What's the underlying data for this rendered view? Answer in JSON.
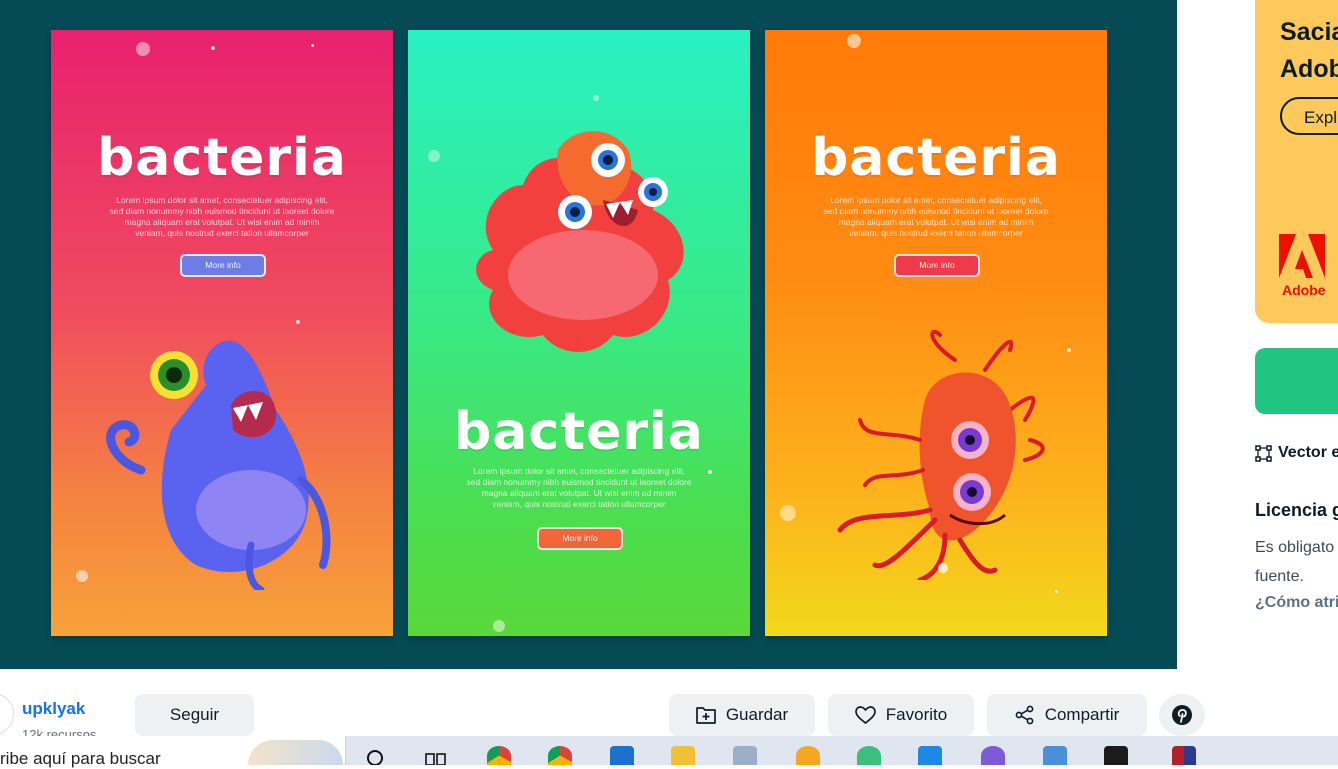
{
  "preview": {
    "posters": [
      {
        "title": "bacteria",
        "body": "Lorem ipsum dolor sit amet, consectetuer adipiscing elit, sed diam nonummy nibh euismod tincidunt ut laoreet dolore magna aliquam erat volutpat. Ut wisi enim ad minim veniam, quis nostrud exerci tation ullamcorper",
        "button": "More info"
      },
      {
        "title": "bacteria",
        "body": "Lorem ipsum dolor sit amet, consectetuer adipiscing elit, sed diam nonummy nibh euismod tincidunt ut laoreet dolore magna aliquam erat volutpat. Ut wisi enim ad minim veniam, quis nostrud exerci tation ullamcorper",
        "button": "More info"
      },
      {
        "title": "bacteria",
        "body": "Lorem ipsum dolor sit amet, consectetuer adipiscing elit, sed diam nonummy nibh euismod tincidunt ut laoreet dolore magna aliquam erat volutpat. Ut wisi enim ad minim veniam, quis nostrud exerci tation ullamcorper",
        "button": "More info"
      }
    ]
  },
  "sidebar": {
    "promo": {
      "text": "Sacia\nAdob",
      "button": "Expl",
      "brand": "Adobe"
    },
    "vector_label": "Vector e",
    "license": {
      "title": "Licencia g",
      "text": "Es obligato\nfuente.",
      "link": "¿Cómo atri"
    }
  },
  "author": {
    "name": "upklyak",
    "resources": "12k recursos"
  },
  "actions": {
    "follow": "Seguir",
    "save": "Guardar",
    "favorite": "Favorito",
    "share": "Compartir"
  },
  "taskbar": {
    "search_placeholder": "ribe aquí para buscar"
  },
  "colors": {
    "preview_bg": "#064a55",
    "promo_bg": "#fdc95a",
    "download": "#1fc581",
    "link": "#1273eb",
    "adobe_red": "#eb1000"
  }
}
